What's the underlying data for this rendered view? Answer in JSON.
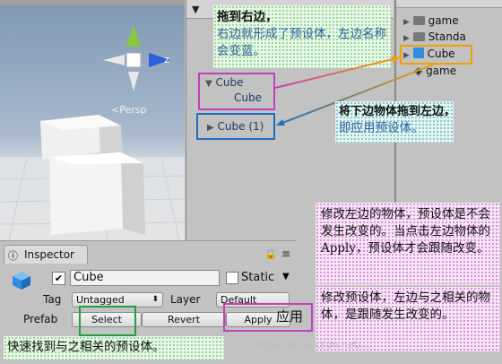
{
  "scene": {
    "persp_label": "<Persp",
    "axis_z_label": "z"
  },
  "hierarchy": {
    "annotation_title": "拖到右边，",
    "annotation_body": "右边就形成了预设体，左边名称会变蓝。",
    "items": [
      {
        "label": "Cube",
        "arrow": "▼"
      },
      {
        "label": "Cube"
      },
      {
        "label": "Cube (1)",
        "arrow": "▶"
      }
    ]
  },
  "project": {
    "items": [
      {
        "label": "game",
        "icon": "folder-icon",
        "arrow": "▶"
      },
      {
        "label": "Standa",
        "icon": "folder-icon",
        "arrow": "▶"
      },
      {
        "label": "Cube",
        "icon": "prefab-cube-icon",
        "arrow": "▶"
      },
      {
        "label": "game",
        "icon": "unity-icon"
      }
    ]
  },
  "drag_note": {
    "title": "将下边物体拖到左边，",
    "body": "即应用预设体。"
  },
  "inspector": {
    "tab_label": "Inspector",
    "name_value": "Cube",
    "static_label": "Static",
    "tag_label": "Tag",
    "tag_value": "Untagged",
    "layer_label": "Layer",
    "layer_value": "Default",
    "prefab_label": "Prefab",
    "select_label": "Select",
    "revert_label": "Revert",
    "apply_label": "Apply",
    "apply_note": "应用",
    "select_note": "快速找到与之相关的预设体。"
  },
  "right_notes": {
    "note1": "修改左边的物体，预设体是不会发生改变的。当点击左边物体的Apply，预设体才会跟随改变。",
    "note2": "修改预设体，左边与之相关的物体，是跟随发生改变的。"
  },
  "watermark": "https://blog.csdn.net/...",
  "colors": {
    "accent_purple": "#c040c0",
    "accent_blue": "#1f6fc0",
    "accent_orange": "#f0a000",
    "accent_green": "#20a040",
    "hier_text": "#1e3c64"
  }
}
